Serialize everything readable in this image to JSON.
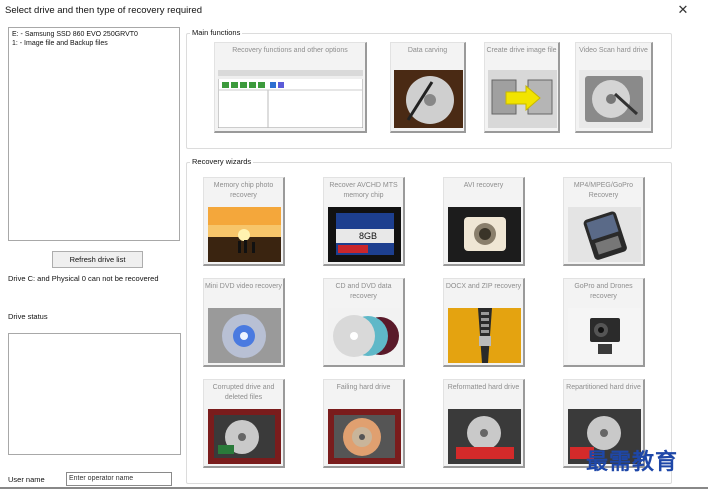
{
  "window": {
    "title": "Select drive and then type of recovery required",
    "close_glyph": "✕"
  },
  "left_panel": {
    "drives": [
      "E: - Samsung  SSD 860 EVO 250GRVT0",
      "1: - Image file and Backup files"
    ],
    "refresh_button": "Refresh drive list",
    "note": "Drive C: and Physical 0 can not be recovered",
    "drive_status_label": "Drive status",
    "user_name_label": "User name",
    "user_name_placeholder": "Enter operator name"
  },
  "main_functions": {
    "title": "Main functions",
    "items": [
      {
        "label": "Recovery functions and other options",
        "icon": "app-screenshot"
      },
      {
        "label": "Data carving",
        "icon": "hard-drive-platter"
      },
      {
        "label": "Create drive image file",
        "icon": "drive-to-image-arrow"
      },
      {
        "label": "Video Scan hard drive",
        "icon": "hard-drive"
      }
    ]
  },
  "recovery_wizards": {
    "title": "Recovery wizards",
    "items": [
      {
        "label": "Memory chip photo recovery",
        "icon": "sunset-photo"
      },
      {
        "label": "Recover AVCHD MTS memory chip",
        "icon": "sd-card"
      },
      {
        "label": "AVI recovery",
        "icon": "camera"
      },
      {
        "label": "MP4/MPEG/GoPro Recovery",
        "icon": "phone"
      },
      {
        "label": "Mini DVD video recovery",
        "icon": "mini-dvd"
      },
      {
        "label": "CD and DVD data recovery",
        "icon": "discs"
      },
      {
        "label": "DOCX and ZIP recovery",
        "icon": "zip"
      },
      {
        "label": "GoPro and Drones recovery",
        "icon": "gopro"
      },
      {
        "label": "Corrupted drive and deleted files",
        "icon": "open-drive"
      },
      {
        "label": "Failing hard drive",
        "icon": "open-drive-platter"
      },
      {
        "label": "Reformatted hard drive",
        "icon": "formatted-drive"
      },
      {
        "label": "Repartitioned hard drive",
        "icon": "repartitioned-drive"
      }
    ]
  },
  "watermark": "最需教育"
}
